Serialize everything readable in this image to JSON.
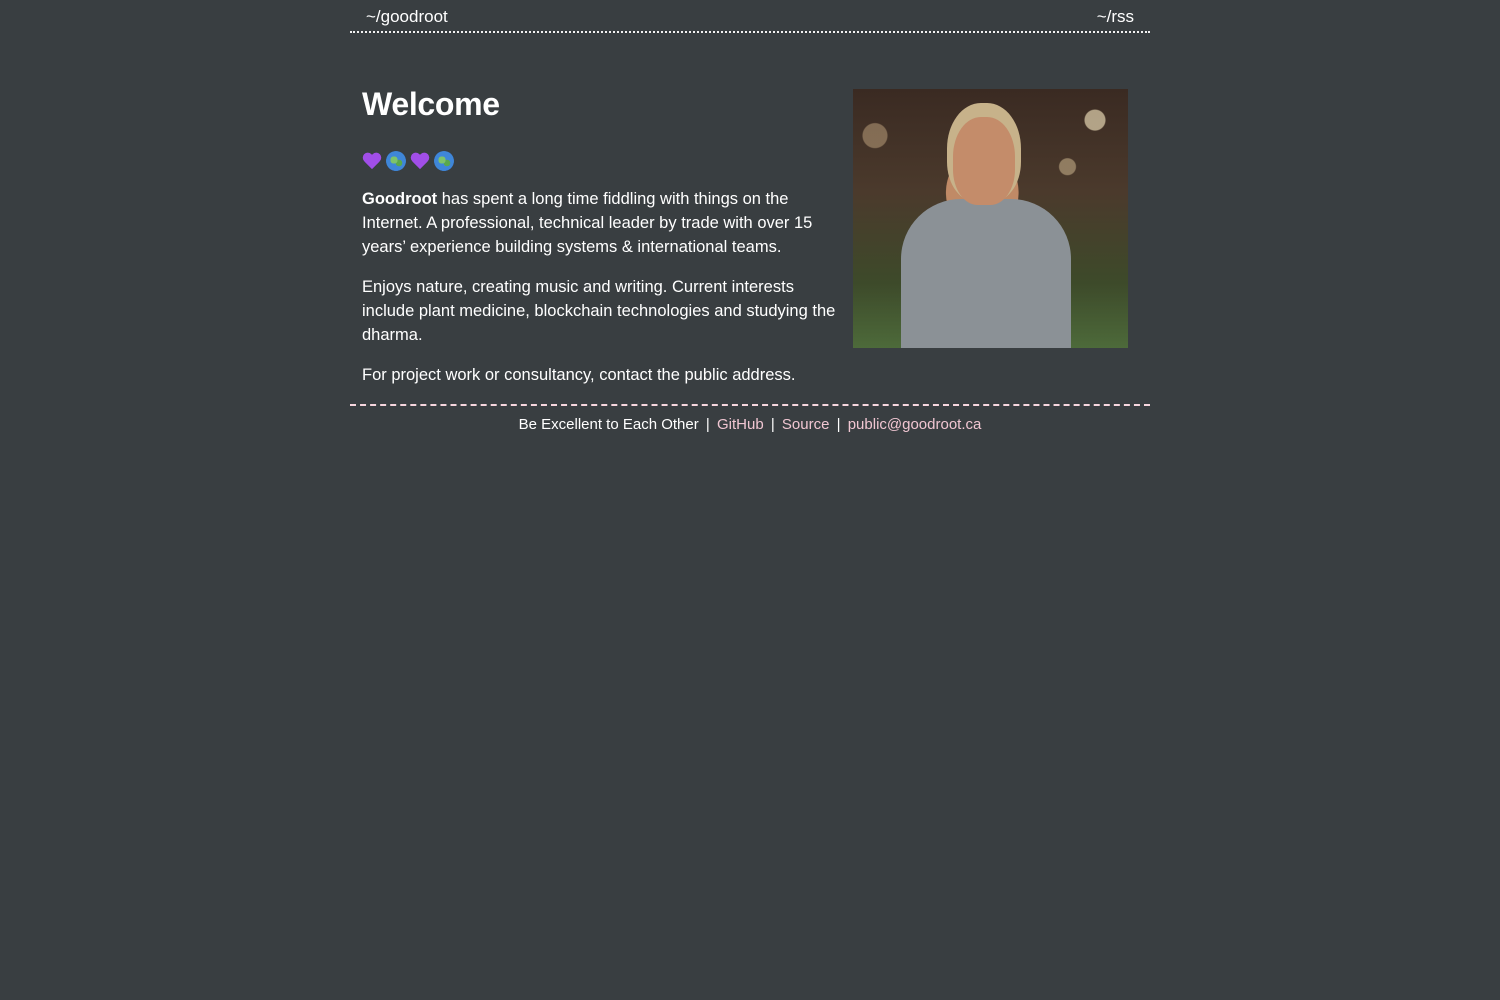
{
  "header": {
    "home_link": "~/goodroot",
    "rss_link": "~/rss"
  },
  "main": {
    "title": "Welcome",
    "emoji": [
      "heart-icon",
      "globe-icon",
      "heart-icon",
      "globe-icon"
    ],
    "name": "Goodroot",
    "paragraph1_rest": " has spent a long time fiddling with things on the Internet. A professional, technical leader by trade with over 15 years’ experience building systems & international teams.",
    "paragraph2": "Enjoys nature, creating music and writing. Current interests include plant medicine, blockchain technologies and studying the dharma.",
    "paragraph3": "For project work or consultancy, contact the public address."
  },
  "footer": {
    "motto": "Be Excellent to Each Other",
    "separator": "|",
    "github": "GitHub",
    "source": "Source",
    "email": "public@goodroot.ca"
  },
  "colors": {
    "background": "#393e41",
    "text": "#ffffff",
    "link": "#f0c6d2",
    "heart": "#a14ee8"
  }
}
